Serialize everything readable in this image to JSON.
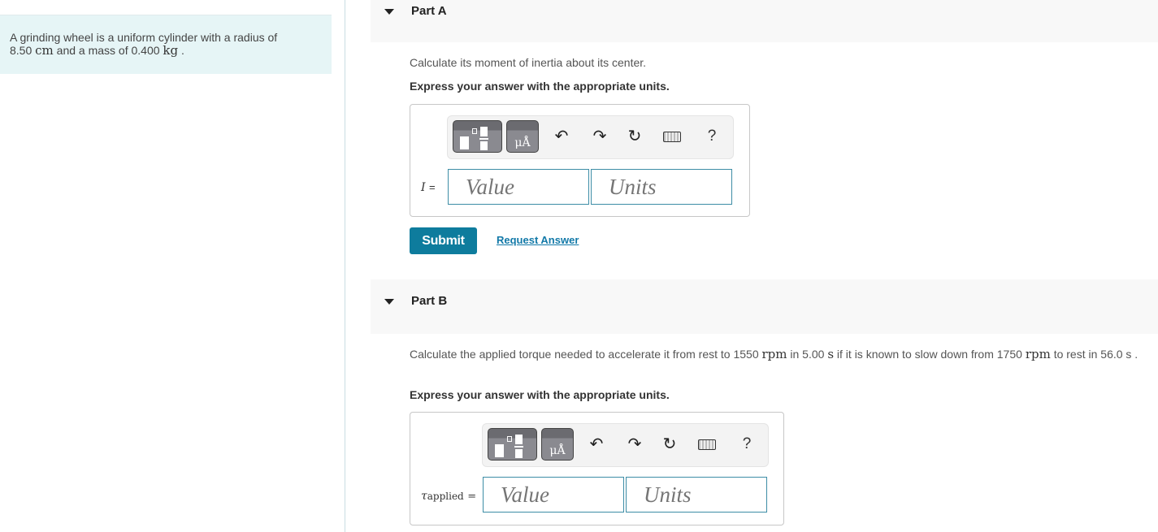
{
  "problem": {
    "text_parts": [
      "A grinding wheel is a uniform cylinder with a radius of",
      "8.50 ",
      "cm",
      " and a mass of 0.400 ",
      "kg",
      " ."
    ]
  },
  "parts": [
    {
      "title": "Part A",
      "prompt": "Calculate its moment of inertia about its center.",
      "instruction": "Express your answer with the appropriate units.",
      "variable": "I",
      "variable_subscript": "",
      "equals": "=",
      "value_placeholder": "Value",
      "units_placeholder": "Units",
      "submit_label": "Submit",
      "request_answer_label": "Request Answer"
    },
    {
      "title": "Part B",
      "prompt_parts": [
        "Calculate the applied torque needed to accelerate it from rest to 1550 ",
        "rpm",
        " in 5.00 ",
        "s",
        " if it is known to slow down from 1750 ",
        "rpm",
        " to rest in 56.0 ",
        "s",
        " ."
      ],
      "instruction": "Express your answer with the appropriate units.",
      "variable": "τ",
      "variable_subscript": "applied",
      "equals": "=",
      "value_placeholder": "Value",
      "units_placeholder": "Units"
    }
  ],
  "toolbar": {
    "templates_icon": "fraction-templates-icon",
    "units_symbol": "μÅ",
    "undo_icon": "undo-icon",
    "redo_icon": "redo-icon",
    "reset_icon": "reset-icon",
    "keyboard_icon": "keyboard-icon",
    "help_label": "?"
  },
  "colors": {
    "accent": "#0e7c9d",
    "link": "#1279a8",
    "problem_bg": "#e6f5f6",
    "field_border": "#3d8da6"
  }
}
